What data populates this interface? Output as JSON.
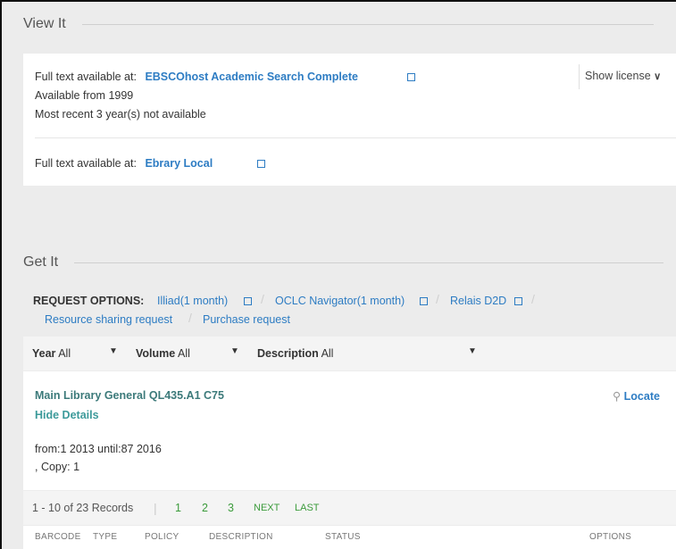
{
  "view_it": {
    "title": "View It",
    "entry1": {
      "prefix": "Full text available at:",
      "link": "EBSCOhost Academic Search Complete",
      "line2": "Available from 1999",
      "line3": "Most recent 3 year(s) not available",
      "license": "Show license"
    },
    "entry2": {
      "prefix": "Full text available at:",
      "link": "Ebrary Local"
    }
  },
  "get_it": {
    "title": "Get It",
    "request_label": "REQUEST OPTIONS:",
    "options": [
      "Illiad(1 month)",
      "OCLC Navigator(1 month)",
      "Relais D2D"
    ],
    "options2": [
      "Resource sharing request",
      "Purchase request"
    ],
    "filters": {
      "year_label": "Year",
      "year_value": "All",
      "volume_label": "Volume",
      "volume_value": "All",
      "description_label": "Description",
      "description_value": "All"
    },
    "holding": {
      "library": "Main Library",
      "location": "General",
      "call_number": "QL435.A1 C75",
      "hide_details": "Hide Details",
      "locate": "Locate",
      "range": "from:1 2013 until:87 2016",
      "copy": ", Copy: 1"
    },
    "pagination": {
      "records": "1 - 10 of 23 Records",
      "pages": [
        "1",
        "2",
        "3"
      ],
      "next": "NEXT",
      "last": "LAST"
    },
    "columns": [
      "BARCODE",
      "TYPE",
      "POLICY",
      "DESCRIPTION",
      "STATUS",
      "OPTIONS"
    ]
  }
}
